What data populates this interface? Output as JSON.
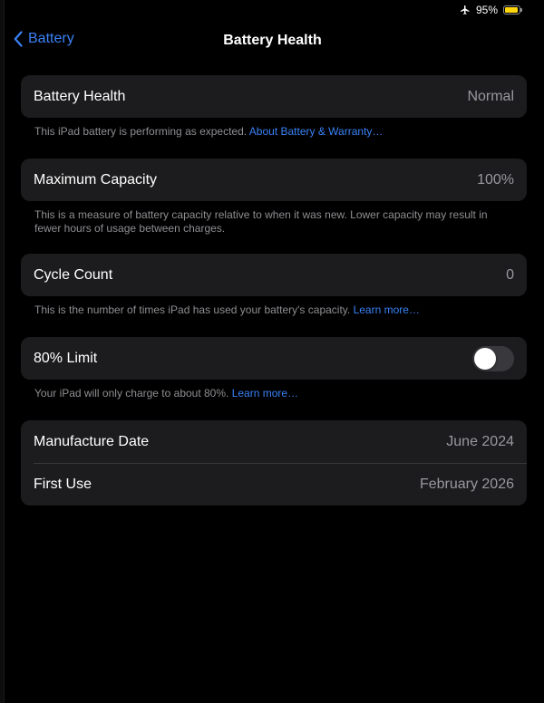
{
  "status_bar": {
    "battery_percent": "95%",
    "battery_level": 0.95,
    "battery_color": "#ffd60a",
    "icons": [
      "airplane-icon",
      "battery-icon"
    ]
  },
  "nav": {
    "back_label": "Battery",
    "title": "Battery Health",
    "accent_color": "#3a82f7"
  },
  "battery_health": {
    "label": "Battery Health",
    "value": "Normal",
    "footer_text": "This iPad battery is performing as expected. ",
    "footer_link": "About Battery & Warranty…"
  },
  "maximum_capacity": {
    "label": "Maximum Capacity",
    "value": "100%",
    "footer_text": "This is a measure of battery capacity relative to when it was new. Lower capacity may result in fewer hours of usage between charges."
  },
  "cycle_count": {
    "label": "Cycle Count",
    "value": "0",
    "footer_text": "This is the number of times iPad has used your battery's capacity. ",
    "footer_link": "Learn more…"
  },
  "charge_limit": {
    "label": "80% Limit",
    "enabled": false,
    "footer_text": "Your iPad will only charge to about 80%. ",
    "footer_link": "Learn more…"
  },
  "dates": {
    "manufacture_label": "Manufacture Date",
    "manufacture_value": "June 2024",
    "first_use_label": "First Use",
    "first_use_value": "February 2026"
  }
}
